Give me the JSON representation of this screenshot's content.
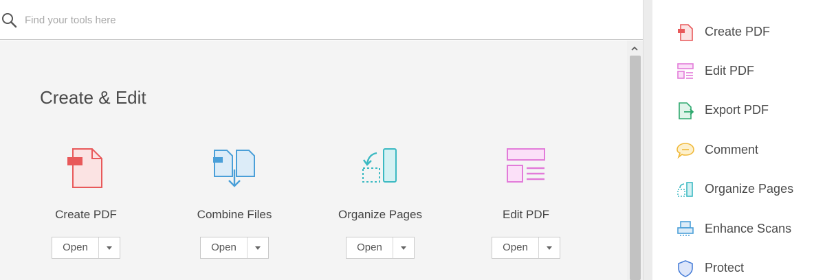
{
  "search": {
    "placeholder": "Find your tools here"
  },
  "section": {
    "title": "Create & Edit"
  },
  "tools": [
    {
      "label": "Create PDF",
      "button": "Open",
      "icon": "create-pdf-icon",
      "color": "#e8595a"
    },
    {
      "label": "Combine Files",
      "button": "Open",
      "icon": "combine-files-icon",
      "color": "#4a9fd8"
    },
    {
      "label": "Organize Pages",
      "button": "Open",
      "icon": "organize-pages-icon",
      "color": "#3bb9c2"
    },
    {
      "label": "Edit PDF",
      "button": "Open",
      "icon": "edit-pdf-icon",
      "color": "#e27bd9"
    }
  ],
  "sidebar": {
    "items": [
      {
        "label": "Create PDF",
        "icon": "create-pdf-icon",
        "color": "#e8595a"
      },
      {
        "label": "Edit PDF",
        "icon": "edit-pdf-icon",
        "color": "#e27bd9"
      },
      {
        "label": "Export PDF",
        "icon": "export-pdf-icon",
        "color": "#2ea86e"
      },
      {
        "label": "Comment",
        "icon": "comment-icon",
        "color": "#f0b93a"
      },
      {
        "label": "Organize Pages",
        "icon": "organize-pages-icon",
        "color": "#3bb9c2"
      },
      {
        "label": "Enhance Scans",
        "icon": "enhance-scans-icon",
        "color": "#4a9fd8"
      },
      {
        "label": "Protect",
        "icon": "protect-icon",
        "color": "#4a7fd8"
      }
    ]
  }
}
